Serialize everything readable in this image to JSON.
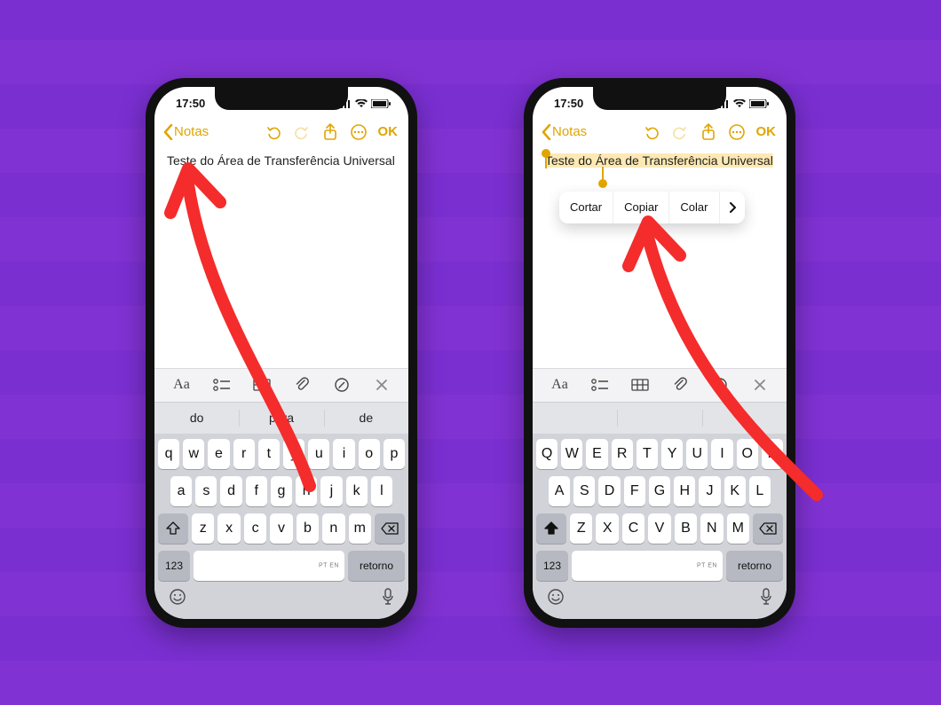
{
  "statusbar": {
    "time": "17:50"
  },
  "navbar": {
    "back_label": "Notas",
    "ok_label": "OK"
  },
  "note": {
    "text": "Teste do Área de Transferência Universal"
  },
  "context_menu": {
    "cut": "Cortar",
    "copy": "Copiar",
    "paste": "Colar",
    "more": "›"
  },
  "formatbar": {
    "aa": "Aa"
  },
  "predictions_left": [
    "do",
    "para",
    "de"
  ],
  "predictions_right": [
    "",
    "",
    ""
  ],
  "keyboard": {
    "row1_lower": [
      "q",
      "w",
      "e",
      "r",
      "t",
      "y",
      "u",
      "i",
      "o",
      "p"
    ],
    "row2_lower": [
      "a",
      "s",
      "d",
      "f",
      "g",
      "h",
      "j",
      "k",
      "l"
    ],
    "row3_lower": [
      "z",
      "x",
      "c",
      "v",
      "b",
      "n",
      "m"
    ],
    "row1_upper": [
      "Q",
      "W",
      "E",
      "R",
      "T",
      "Y",
      "U",
      "I",
      "O",
      "P"
    ],
    "row2_upper": [
      "A",
      "S",
      "D",
      "F",
      "G",
      "H",
      "J",
      "K",
      "L"
    ],
    "row3_upper": [
      "Z",
      "X",
      "C",
      "V",
      "B",
      "N",
      "M"
    ],
    "num_label": "123",
    "return_label": "retorno",
    "space_lang": "PT EN"
  },
  "colors": {
    "accent": "#e0a500",
    "background": "#7a2fd1",
    "arrow": "#f42c2c"
  }
}
